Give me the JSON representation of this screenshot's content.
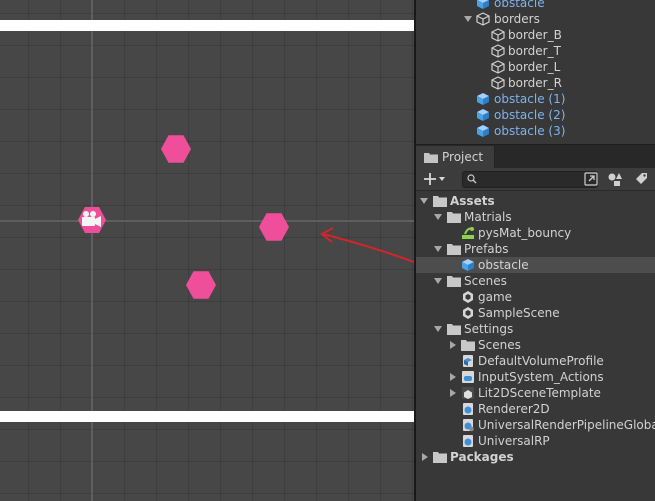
{
  "hierarchy": {
    "items": [
      {
        "label": "obstacle",
        "type": "prefab"
      },
      {
        "label": "borders",
        "type": "object"
      },
      {
        "label": "border_B",
        "type": "object"
      },
      {
        "label": "border_T",
        "type": "object"
      },
      {
        "label": "border_L",
        "type": "object"
      },
      {
        "label": "border_R",
        "type": "object"
      },
      {
        "label": "obstacle (1)",
        "type": "prefab"
      },
      {
        "label": "obstacle (2)",
        "type": "prefab"
      },
      {
        "label": "obstacle (3)",
        "type": "prefab"
      }
    ]
  },
  "project": {
    "tab_label": "Project",
    "search": {
      "value": "",
      "placeholder": ""
    },
    "items": [
      {
        "label": "Assets",
        "type": "folder"
      },
      {
        "label": "Matrials",
        "type": "folder"
      },
      {
        "label": "pysMat_bouncy",
        "type": "physics-material"
      },
      {
        "label": "Prefabs",
        "type": "folder"
      },
      {
        "label": "obstacle",
        "type": "prefab",
        "selected": true
      },
      {
        "label": "Scenes",
        "type": "folder"
      },
      {
        "label": "game",
        "type": "scene"
      },
      {
        "label": "SampleScene",
        "type": "scene"
      },
      {
        "label": "Settings",
        "type": "folder"
      },
      {
        "label": "Scenes",
        "type": "folder"
      },
      {
        "label": "DefaultVolumeProfile",
        "type": "asset"
      },
      {
        "label": "InputSystem_Actions",
        "type": "input-actions"
      },
      {
        "label": "Lit2DSceneTemplate",
        "type": "scene-template"
      },
      {
        "label": "Renderer2D",
        "type": "asset"
      },
      {
        "label": "UniversalRenderPipelineGlobalSettings",
        "type": "asset"
      },
      {
        "label": "UniversalRP",
        "type": "asset"
      },
      {
        "label": "Packages",
        "type": "folder"
      }
    ]
  },
  "colors": {
    "obstacle": "#ef4f9a",
    "arrow": "#d0262b",
    "prefab_label": "#7db3ee",
    "prefab_icon": "#4aa3e8"
  },
  "icons": {
    "add": "plus-icon",
    "search": "search-icon",
    "folder": "folder-icon",
    "prefab": "prefab-cube-icon",
    "object": "cube-outline-icon",
    "scene": "unity-scene-icon"
  }
}
